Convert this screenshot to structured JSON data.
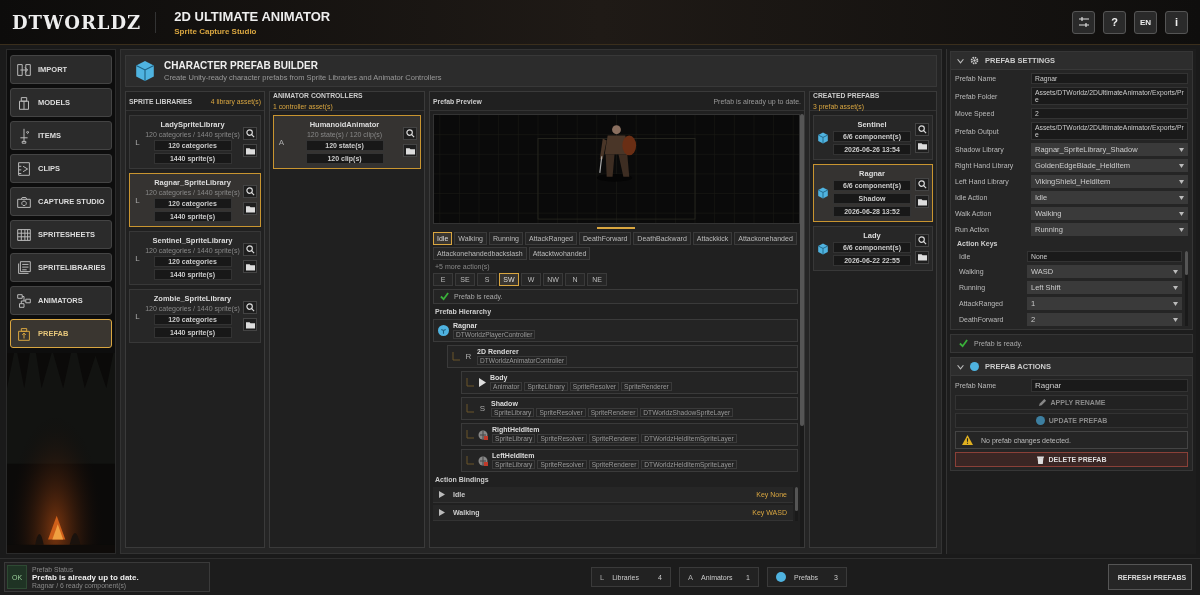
{
  "header": {
    "logo": "DTWORLDZ",
    "title": "2D ULTIMATE ANIMATOR",
    "subtitle": "Sprite Capture Studio",
    "help": "?",
    "language": "EN",
    "info": "i"
  },
  "nav": [
    {
      "label": "IMPORT",
      "selected": false
    },
    {
      "label": "MODELS",
      "selected": false
    },
    {
      "label": "ITEMS",
      "selected": false
    },
    {
      "label": "CLIPS",
      "selected": false
    },
    {
      "label": "CAPTURE STUDIO",
      "selected": false
    },
    {
      "label": "SPRITESHEETS",
      "selected": false
    },
    {
      "label": "SPRITELIBRARIES",
      "selected": false
    },
    {
      "label": "ANIMATORS",
      "selected": false
    },
    {
      "label": "PREFAB",
      "selected": true
    }
  ],
  "builder": {
    "title": "CHARACTER PREFAB BUILDER",
    "subtitle": "Create Unity-ready character prefabs from Sprite Libraries and Animator Controllers"
  },
  "sprite_libraries": {
    "heading": "SPRITE LIBRARIES",
    "count": "4 library asset(s)",
    "items": [
      {
        "letter": "L",
        "name": "LadySpriteLibrary",
        "summary": "120 categories / 1440 sprite(s)",
        "chips": [
          "120 categories",
          "1440 sprite(s)"
        ],
        "selected": false
      },
      {
        "letter": "L",
        "name": "Ragnar_SpriteLibrary",
        "summary": "120 categories / 1440 sprite(s)",
        "chips": [
          "120 categories",
          "1440 sprite(s)"
        ],
        "selected": true
      },
      {
        "letter": "L",
        "name": "Sentinel_SpriteLibrary",
        "summary": "120 categories / 1440 sprite(s)",
        "chips": [
          "120 categories",
          "1440 sprite(s)"
        ],
        "selected": false
      },
      {
        "letter": "L",
        "name": "Zombie_SpriteLibrary",
        "summary": "120 categories / 1440 sprite(s)",
        "chips": [
          "120 categories",
          "1440 sprite(s)"
        ],
        "selected": false
      }
    ]
  },
  "animator_controllers": {
    "heading": "ANIMATOR CONTROLLERS",
    "count": "1 controller asset(s)",
    "items": [
      {
        "letter": "A",
        "name": "HumanoidAnimator",
        "summary": "120 state(s) / 120 clip(s)",
        "chips": [
          "120 state(s)",
          "120 clip(s)"
        ],
        "selected": true
      }
    ]
  },
  "preview": {
    "heading": "Prefab Preview",
    "status": "Prefab is already up to date.",
    "actions": [
      {
        "label": "Idle",
        "selected": true
      },
      {
        "label": "Walking",
        "selected": false
      },
      {
        "label": "Running",
        "selected": false
      },
      {
        "label": "AttackRanged",
        "selected": false
      },
      {
        "label": "DeathForward",
        "selected": false
      },
      {
        "label": "DeathBackward",
        "selected": false
      },
      {
        "label": "Attackkick",
        "selected": false
      },
      {
        "label": "Attackonehanded",
        "selected": false
      },
      {
        "label": "Attackonehandedbackslash",
        "selected": false
      },
      {
        "label": "Attacktwohanded",
        "selected": false
      }
    ],
    "more_actions": "+5 more action(s)",
    "directions": [
      {
        "label": "E",
        "selected": false
      },
      {
        "label": "SE",
        "selected": false
      },
      {
        "label": "S",
        "selected": false
      },
      {
        "label": "SW",
        "selected": true
      },
      {
        "label": "W",
        "selected": false
      },
      {
        "label": "NW",
        "selected": false
      },
      {
        "label": "N",
        "selected": false
      },
      {
        "label": "NE",
        "selected": false
      }
    ],
    "ready": "Prefab is ready.",
    "hierarchy_heading": "Prefab Hierarchy",
    "hierarchy": [
      {
        "name": "Ragnar",
        "kind": "root",
        "components": [
          "DTWorldzPlayerController"
        ],
        "children": [
          {
            "name": "2D Renderer",
            "kind": "letter",
            "badge": "R",
            "components": [
              "DTWorldzAnimatorController"
            ],
            "children": [
              {
                "name": "Body",
                "kind": "body",
                "components": [
                  "Animator",
                  "SpriteLibrary",
                  "SpriteResolver",
                  "SpriteRenderer"
                ]
              },
              {
                "name": "Shadow",
                "kind": "letter",
                "badge": "S",
                "components": [
                  "SpriteLibrary",
                  "SpriteResolver",
                  "SpriteRenderer",
                  "DTWorldzShadowSpriteLayer"
                ]
              },
              {
                "name": "RightHeldItem",
                "kind": "item",
                "components": [
                  "SpriteLibrary",
                  "SpriteResolver",
                  "SpriteRenderer",
                  "DTWorldzHeldItemSpriteLayer"
                ]
              },
              {
                "name": "LeftHeldItem",
                "kind": "item",
                "components": [
                  "SpriteLibrary",
                  "SpriteResolver",
                  "SpriteRenderer",
                  "DTWorldzHeldItemSpriteLayer"
                ]
              }
            ]
          }
        ]
      }
    ],
    "bindings_heading": "Action Bindings",
    "bindings": [
      {
        "name": "Idle",
        "key": "Key None"
      },
      {
        "name": "Walking",
        "key": "Key WASD"
      }
    ]
  },
  "created_prefabs": {
    "heading": "CREATED PREFABS",
    "count": "3 prefab asset(s)",
    "items": [
      {
        "name": "Sentinel",
        "chips": [
          "6/6 component(s)",
          "2026-06-26 13:54"
        ],
        "selected": false
      },
      {
        "name": "Ragnar",
        "chips": [
          "6/6 component(s)",
          "Shadow",
          "2026-06-28 13:52"
        ],
        "selected": true
      },
      {
        "name": "Lady",
        "chips": [
          "6/6 component(s)",
          "2026-06-22 22:55"
        ],
        "selected": false
      }
    ]
  },
  "settings": {
    "title": "PREFAB SETTINGS",
    "expanded": true,
    "fields": [
      {
        "label": "Prefab Name",
        "value": "Ragnar",
        "kind": "text"
      },
      {
        "label": "Prefab Folder",
        "value": "Assets/DTWorldz/2DUltimateAnimator/Exports/Pre",
        "kind": "text"
      },
      {
        "label": "Move Speed",
        "value": "2",
        "kind": "text"
      },
      {
        "label": "Prefab Output",
        "value": "Assets/DTWorldz/2DUltimateAnimator/Exports/Pre",
        "kind": "text"
      },
      {
        "label": "Shadow Library",
        "value": "Ragnar_SpriteLibrary_Shadow",
        "kind": "select"
      },
      {
        "label": "Right Hand Library",
        "value": "GoldenEdgeBlade_HeldItem",
        "kind": "select"
      },
      {
        "label": "Left Hand Library",
        "value": "VikingShield_HeldItem",
        "kind": "select"
      },
      {
        "label": "Idle Action",
        "value": "Idle",
        "kind": "select"
      },
      {
        "label": "Walk Action",
        "value": "Walking",
        "kind": "select"
      },
      {
        "label": "Run Action",
        "value": "Running",
        "kind": "select"
      }
    ],
    "keys_heading": "Action Keys",
    "keys": [
      {
        "label": "Idle",
        "value": "None",
        "kind": "text"
      },
      {
        "label": "Walking",
        "value": "WASD",
        "kind": "select"
      },
      {
        "label": "Running",
        "value": "Left Shift",
        "kind": "select"
      },
      {
        "label": "AttackRanged",
        "value": "1",
        "kind": "select"
      },
      {
        "label": "DeathForward",
        "value": "2",
        "kind": "select"
      }
    ],
    "ready": "Prefab is ready."
  },
  "actions_panel": {
    "title": "PREFAB ACTIONS",
    "expanded": true,
    "name_label": "Prefab Name",
    "name_value": "Ragnar",
    "buttons": [
      {
        "label": "APPLY RENAME",
        "kind": "rename",
        "disabled": true
      },
      {
        "label": "UPDATE PREFAB",
        "kind": "update",
        "disabled": true
      }
    ],
    "warning": "No prefab changes detected.",
    "delete": "DELETE PREFAB"
  },
  "status": {
    "badge": "OK",
    "label": "Prefab Status",
    "message": "Prefab is already up to date.",
    "detail": "Ragnar / 6 ready component(s)"
  },
  "counters": [
    {
      "kind": "letter",
      "letter": "L",
      "label": "Libraries",
      "value": "4"
    },
    {
      "kind": "letter",
      "letter": "A",
      "label": "Animators",
      "value": "1"
    },
    {
      "kind": "prefab",
      "label": "Prefabs",
      "value": "3"
    }
  ],
  "refresh": "REFRESH PREFABS"
}
